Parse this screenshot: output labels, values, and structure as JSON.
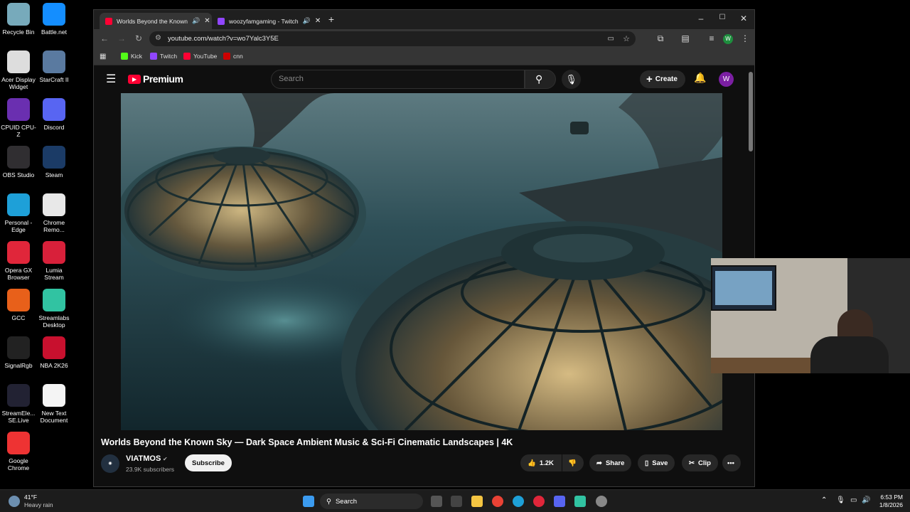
{
  "desktop_icons": [
    {
      "label": "Recycle Bin",
      "icon": "recycle-bin-icon",
      "color": "#7ab"
    },
    {
      "label": "Battle.net",
      "icon": "battlenet-icon",
      "color": "#148eff"
    },
    {
      "label": "Acer Display Widget",
      "icon": "display-widget-icon",
      "color": "#ddd"
    },
    {
      "label": "StarCraft II",
      "icon": "starcraft-icon",
      "color": "#5a7aa0"
    },
    {
      "label": "CPUID CPU-Z",
      "icon": "cpuz-icon",
      "color": "#6a2fb0"
    },
    {
      "label": "Discord",
      "icon": "discord-icon",
      "color": "#5865f2"
    },
    {
      "label": "OBS Studio",
      "icon": "obs-icon",
      "color": "#302e31"
    },
    {
      "label": "Steam",
      "icon": "steam-icon",
      "color": "#1b3b66"
    },
    {
      "label": "Personal - Edge",
      "icon": "edge-icon",
      "color": "#1ea0d8"
    },
    {
      "label": "Chrome Remo...",
      "icon": "chrome-remote-icon",
      "color": "#e8e8e8"
    },
    {
      "label": "Opera GX Browser",
      "icon": "opera-gx-icon",
      "color": "#e0263a"
    },
    {
      "label": "Lumia Stream",
      "icon": "lumia-icon",
      "color": "#d8203a"
    },
    {
      "label": "GCC",
      "icon": "gcc-icon",
      "color": "#e8601a"
    },
    {
      "label": "Streamlabs Desktop",
      "icon": "streamlabs-icon",
      "color": "#31c3a2"
    },
    {
      "label": "SignalRgb",
      "icon": "signalrgb-icon",
      "color": "#222"
    },
    {
      "label": "NBA 2K26",
      "icon": "nba2k-icon",
      "color": "#c8102e"
    },
    {
      "label": "StreamEle... SE.Live",
      "icon": "streamelements-icon",
      "color": "#223"
    },
    {
      "label": "New Text Document",
      "icon": "text-document-icon",
      "color": "#f4f4f4"
    },
    {
      "label": "Google Chrome",
      "icon": "chrome-icon",
      "color": "#e33"
    }
  ],
  "browser": {
    "tabs": [
      {
        "title": "Worlds Beyond the Known",
        "favicon_color": "#ff0033"
      },
      {
        "title": "woozyfamgaming - Twitch",
        "favicon_color": "#9146ff"
      }
    ],
    "url": "youtube.com/watch?v=wo7Yalc3Y5E",
    "profile_initial": "W",
    "bookmarks": [
      {
        "label": "Kick",
        "color": "#53fc18"
      },
      {
        "label": "Twitch",
        "color": "#9146ff"
      },
      {
        "label": "YouTube",
        "color": "#ff0033"
      },
      {
        "label": "cnn",
        "color": "#cc0000"
      }
    ]
  },
  "youtube": {
    "logo_text": "Premium",
    "search_placeholder": "Search",
    "create_label": "Create",
    "avatar_initial": "W",
    "video_title": "Worlds Beyond the Known Sky — Dark Space Ambient Music & Sci-Fi Cinematic Landscapes | 4K",
    "channel_name": "VIATMOS",
    "subscribers": "23.9K subscribers",
    "subscribe_label": "Subscribe",
    "likes": "1.2K",
    "share_label": "Share",
    "save_label": "Save",
    "clip_label": "Clip"
  },
  "taskbar": {
    "weather_temp": "41°F",
    "weather_desc": "Heavy rain",
    "search_label": "Search",
    "time": "6:53 PM",
    "date": "1/8/2026"
  }
}
